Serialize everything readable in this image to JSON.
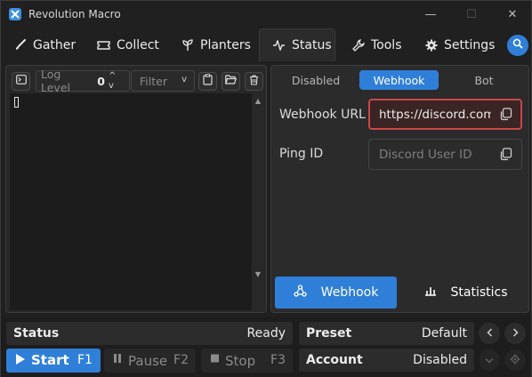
{
  "window": {
    "title": "Revolution Macro",
    "minimize_icon": "—",
    "maximize_icon": "☐",
    "close_icon": "✕"
  },
  "tabs": [
    {
      "label": "Gather",
      "icon": "brush-icon"
    },
    {
      "label": "Collect",
      "icon": "ticket-icon"
    },
    {
      "label": "Planters",
      "icon": "sprout-icon"
    },
    {
      "label": "Status",
      "icon": "pulse-icon",
      "active": true
    },
    {
      "label": "Tools",
      "icon": "wrench-icon"
    },
    {
      "label": "Settings",
      "icon": "gear-icon"
    }
  ],
  "console": {
    "log_level_label": "Log Level",
    "log_level_value": "0",
    "log_level_arrows": "^ v",
    "filter_label": "Filter",
    "filter_chevron": "v"
  },
  "webhook_panel": {
    "modes": [
      "Disabled",
      "Webhook",
      "Bot"
    ],
    "selected_mode": "Webhook",
    "webhook_url_label": "Webhook URL",
    "webhook_url_value": "https://discord.com/api/webhooks/",
    "ping_id_label": "Ping ID",
    "ping_id_placeholder": "Discord User ID",
    "webhook_button": "Webhook",
    "statistics_button": "Statistics"
  },
  "bottom": {
    "status_label": "Status",
    "status_value": "Ready",
    "preset_label": "Preset",
    "preset_value": "Default",
    "account_label": "Account",
    "account_value": "Disabled",
    "start_label": "Start",
    "start_key": "F1",
    "pause_label": "Pause",
    "pause_key": "F2",
    "stop_label": "Stop",
    "stop_key": "F3"
  },
  "colors": {
    "accent": "#2f7fd8",
    "error_border": "#c9474a",
    "background": "#202020"
  }
}
